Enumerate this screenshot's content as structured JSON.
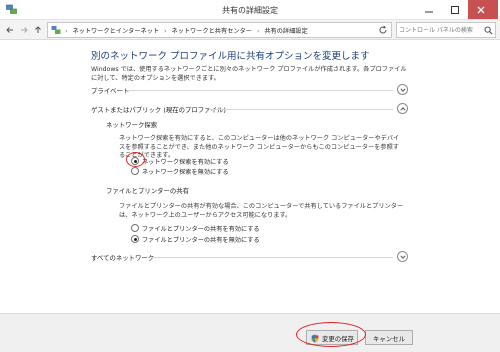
{
  "window": {
    "title": "共有の詳細設定"
  },
  "address": {
    "breadcrumbs": [
      "ネットワークとインターネット",
      "ネットワークと共有センター",
      "共有の詳細設定"
    ],
    "separator": "›",
    "dropdown_symbol": "⌄",
    "refresh_symbol": "↻"
  },
  "search": {
    "placeholder": "コントロール パネルの検索"
  },
  "page": {
    "title": "別のネットワーク プロファイル用に共有オプションを変更します",
    "intro": "Windows では、使用するネットワークごとに別々のネットワーク プロファイルが作成されます。各プロファイルに対して、特定のオプションを選択できます。"
  },
  "sections": {
    "private": {
      "label": "プライベート",
      "expanded": false
    },
    "guest_public": {
      "label": "ゲストまたはパブリック (現在のプロファイル)",
      "expanded": true,
      "network_discovery": {
        "heading": "ネットワーク探索",
        "description": "ネットワーク探索を有効にすると、このコンピューターは他のネットワーク コンピューターやデバイスを参照することができ、また他のネットワーク コンピューターからもこのコンピューターを参照することができます。",
        "options": [
          {
            "label": "ネットワーク探索を有効にする",
            "checked": true
          },
          {
            "label": "ネットワーク探索を無効にする",
            "checked": false
          }
        ]
      },
      "file_printer_sharing": {
        "heading": "ファイルとプリンターの共有",
        "description": "ファイルとプリンターの共有が有効な場合、このコンピューターで共有しているファイルとプリンターは、ネットワーク上のユーザーからアクセス可能になります。",
        "options": [
          {
            "label": "ファイルとプリンターの共有を有効にする",
            "checked": false
          },
          {
            "label": "ファイルとプリンターの共有を無効にする",
            "checked": true
          }
        ]
      }
    },
    "all_networks": {
      "label": "すべてのネットワーク",
      "expanded": false
    }
  },
  "footer": {
    "save_label": "変更の保存",
    "cancel_label": "キャンセル"
  },
  "colors": {
    "title_blue": "#1a3f7a",
    "close_red": "#c75050",
    "annotation_red": "#d9262a"
  },
  "icons": {
    "app": "network-sharing-icon",
    "back": "back-arrow-icon",
    "forward": "forward-arrow-icon",
    "up": "up-arrow-icon",
    "search": "search-icon",
    "expand": "chevron-down-icon",
    "collapse": "chevron-up-icon",
    "uac": "uac-shield-icon"
  }
}
